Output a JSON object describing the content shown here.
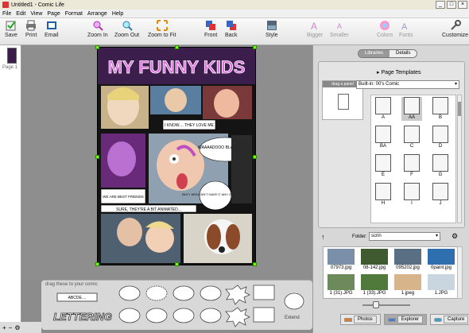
{
  "window": {
    "title": "Untitled1 - Comic Life",
    "buttons": [
      "_",
      "□",
      "×"
    ]
  },
  "menu": [
    "File",
    "Edit",
    "View",
    "Page",
    "Format",
    "Arrange",
    "Help"
  ],
  "toolbar": {
    "save": "Save",
    "print": "Print",
    "email": "Email",
    "zoom_in": "Zoom In",
    "zoom_out": "Zoom Out",
    "zoom_fit": "Zoom to Fit",
    "front": "Front",
    "back": "Back",
    "style": "Style",
    "bigger": "Bigger",
    "smaller": "Smaller",
    "colors": "Colors",
    "fonts": "Fonts",
    "customize": "Customize"
  },
  "pages_panel": {
    "page_label": "Page 1"
  },
  "comic": {
    "title": "MY FUNNY KIDS",
    "captions": [
      "I KNOW.... THEY LOVE ME",
      "WAAAADOOO BLAAARRRR!!",
      "BUT I WOULDN'T HAVE IT ANY OTHER WAY!",
      "WE ARE BEST FRIENDS",
      "SURE, THEY'RE A BIT ANIMATED..."
    ]
  },
  "palette": {
    "hint": "drag these to your comic",
    "lettering_small": "ABCDE....",
    "lettering_big": "LETTERING",
    "extend": "Extend"
  },
  "right_panel": {
    "tabs": [
      "Libraries",
      "Details"
    ],
    "page_templates": "Page Templates",
    "template_set": "Built-in: 00's Comic",
    "drag_panel": "drag a panel",
    "templates": [
      "A",
      "AA",
      "B",
      "BA",
      "C",
      "D",
      "E",
      "F",
      "G",
      "H",
      "I",
      "J"
    ],
    "folder_label": "Folder:",
    "folder_value": "scrin",
    "files": [
      "07973.jpg",
      "08-142.jpg",
      "095202.jpg",
      "0paint.jpg",
      "1 (31).JPG",
      "1 (33).JPG",
      "1.jpeg",
      "1.JPG"
    ],
    "bottom_tabs": [
      "Photos",
      "Explorer",
      "Capture"
    ]
  },
  "bottombar": [
    "+",
    "−",
    "⚙"
  ],
  "colors": {
    "accent_green": "#7cfc00",
    "title_pink": "#e070e0"
  }
}
